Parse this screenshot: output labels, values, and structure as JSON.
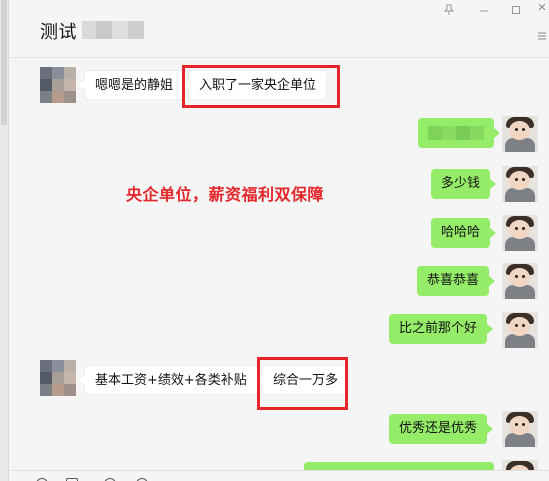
{
  "chat": {
    "title": "测试"
  },
  "window_controls": {
    "pin": "pin-icon",
    "minimize": "minimize-icon",
    "maximize": "maximize-icon"
  },
  "messages": [
    {
      "sender": "other",
      "nickname": "嗯嗯是的静姐",
      "text": "入职了一家央企单位",
      "highlighted": true
    },
    {
      "sender": "me",
      "text": "",
      "blurred": true
    },
    {
      "sender": "me",
      "text": "多少钱"
    },
    {
      "sender": "me",
      "text": "哈哈哈"
    },
    {
      "sender": "me",
      "text": "恭喜恭喜"
    },
    {
      "sender": "me",
      "text": "比之前那个好"
    },
    {
      "sender": "other",
      "nickname": "基本工资+绩效+各类补贴",
      "text": "综合一万多",
      "highlighted": true
    },
    {
      "sender": "me",
      "text": "优秀还是优秀"
    }
  ],
  "annotation": {
    "text": "央企单位，薪资福利双保障",
    "color": "#e4262a"
  },
  "colors": {
    "outgoing_bubble": "#95ec69",
    "incoming_bubble": "#ffffff",
    "background": "#f5f5f5",
    "highlight_box": "#e4262a"
  }
}
